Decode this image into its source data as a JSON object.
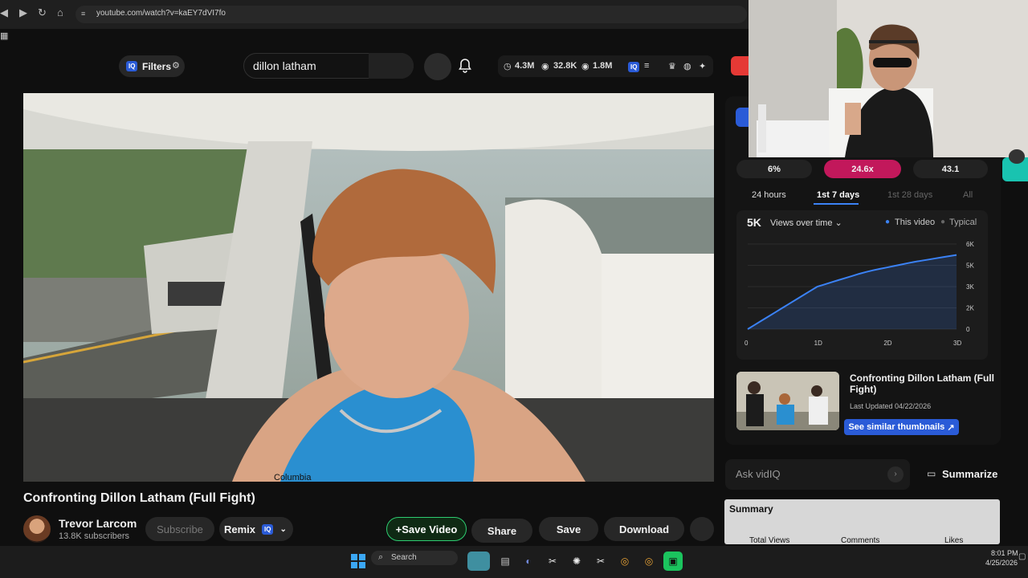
{
  "browser": {
    "url": "youtube.com/watch?v=kaEY7dVI7fo"
  },
  "header": {
    "filters_label": "Filters",
    "search_query": "dillon latham",
    "stats": [
      "4.3M",
      "32.8K",
      "1.8M"
    ],
    "iq_badge": "IQ"
  },
  "video": {
    "title": "Confronting Dillon Latham (Full Fight)",
    "channel_name": "Trevor Larcom",
    "channel_subs": "13.8K subscribers",
    "shirt_text": "Columbia"
  },
  "actions": {
    "subscribe": "Subscribe",
    "remix": "Remix",
    "save_video": "+Save Video",
    "share": "Share",
    "save": "Save",
    "download": "Download"
  },
  "vidiq": {
    "ratios": [
      "6%",
      "24.6x",
      "43.1"
    ],
    "tabs": [
      "24 hours",
      "1st 7 days",
      "1st 28 days",
      "All"
    ],
    "active_tab": "1st 7 days",
    "views_total": "5K",
    "views_dropdown": "Views over time",
    "legend_this": "This video",
    "legend_typical": "Typical",
    "thumb_title": "Confronting Dillon Latham (Full Fight)",
    "last_updated": "Last Updated 04/22/2026",
    "similar_button": "See similar thumbnails",
    "ask_placeholder": "Ask vidIQ",
    "summarize": "Summarize",
    "summary_title": "Summary",
    "summary_cols": [
      "Total Views",
      "Comments",
      "Likes"
    ],
    "colors": {
      "line": "#3b82f6",
      "accent": "#c2185b",
      "brand": "#2a5bd7"
    }
  },
  "chart_data": {
    "type": "line",
    "x": [
      0,
      1,
      2,
      3,
      4,
      5,
      6,
      7,
      8,
      9,
      10,
      11,
      12,
      13,
      14,
      15,
      16,
      17,
      18,
      19,
      20,
      21,
      22,
      23,
      24,
      25,
      26,
      27,
      28,
      29,
      30
    ],
    "series": [
      {
        "name": "This video",
        "values": [
          0,
          300,
          600,
          900,
          1200,
          1500,
          1800,
          2100,
          2400,
          2700,
          3000,
          3150,
          3300,
          3450,
          3600,
          3750,
          3900,
          4030,
          4150,
          4250,
          4350,
          4450,
          4550,
          4650,
          4750,
          4830,
          4910,
          4990,
          5070,
          5150,
          5230
        ]
      }
    ],
    "xticks": [
      "0",
      "1D",
      "2D",
      "3D"
    ],
    "yticks": [
      "0",
      "2K",
      "3K",
      "5K",
      "6K"
    ],
    "ylim": [
      0,
      6000
    ]
  },
  "taskbar": {
    "search_label": "Search",
    "time": "8:01 PM",
    "date": "4/25/2026"
  }
}
